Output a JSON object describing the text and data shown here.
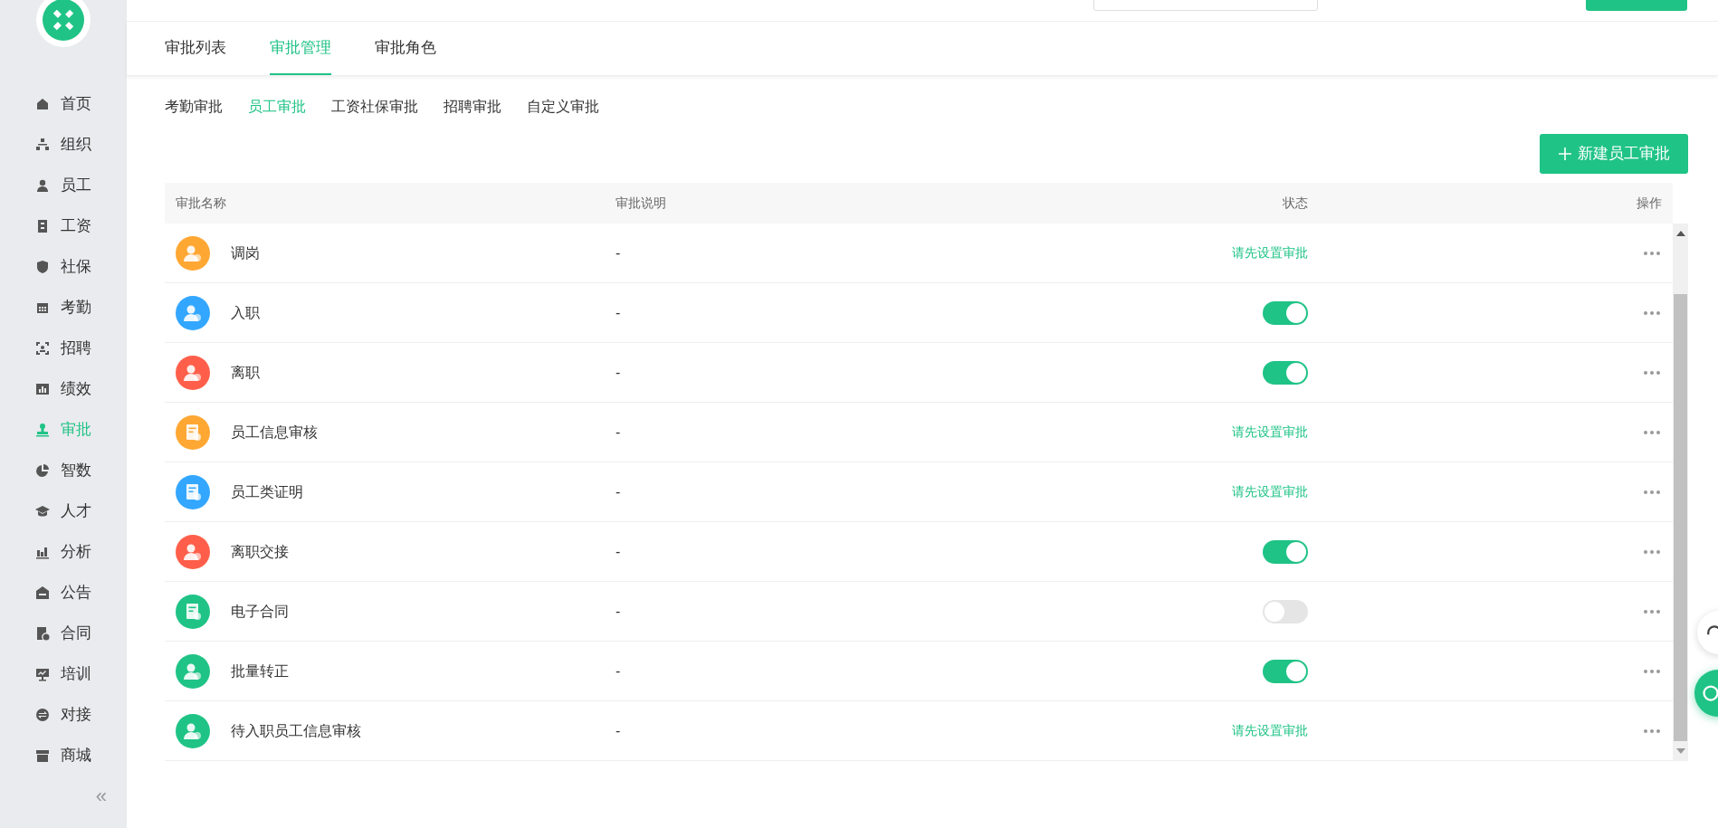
{
  "sidebar": {
    "items": [
      {
        "label": "首页",
        "selected": false
      },
      {
        "label": "组织",
        "selected": false
      },
      {
        "label": "员工",
        "selected": false
      },
      {
        "label": "工资",
        "selected": false
      },
      {
        "label": "社保",
        "selected": false
      },
      {
        "label": "考勤",
        "selected": false
      },
      {
        "label": "招聘",
        "selected": false
      },
      {
        "label": "绩效",
        "selected": false
      },
      {
        "label": "审批",
        "selected": true
      },
      {
        "label": "智数",
        "selected": false
      },
      {
        "label": "人才",
        "selected": false
      },
      {
        "label": "分析",
        "selected": false
      },
      {
        "label": "公告",
        "selected": false
      },
      {
        "label": "合同",
        "selected": false
      },
      {
        "label": "培训",
        "selected": false
      },
      {
        "label": "对接",
        "selected": false
      },
      {
        "label": "商城",
        "selected": false
      }
    ],
    "collapse": "«"
  },
  "tabs": [
    {
      "label": "审批列表",
      "selected": false
    },
    {
      "label": "审批管理",
      "selected": true
    },
    {
      "label": "审批角色",
      "selected": false
    }
  ],
  "subtabs": [
    {
      "label": "考勤审批",
      "selected": false
    },
    {
      "label": "员工审批",
      "selected": true
    },
    {
      "label": "工资社保审批",
      "selected": false
    },
    {
      "label": "招聘审批",
      "selected": false
    },
    {
      "label": "自定义审批",
      "selected": false
    }
  ],
  "new_button": "新建员工审批",
  "table": {
    "columns": [
      "审批名称",
      "审批说明",
      "状态",
      "操作"
    ],
    "rows": [
      {
        "name": "调岗",
        "color": "#ffa733",
        "description": "-",
        "kind": "text",
        "status": "请先设置审批"
      },
      {
        "name": "入职",
        "color": "#33a7ff",
        "description": "-",
        "kind": "switch",
        "on": true
      },
      {
        "name": "离职",
        "color": "#ff5f4a",
        "description": "-",
        "kind": "switch",
        "on": true
      },
      {
        "name": "员工信息审核",
        "color": "#ffa733",
        "description": "-",
        "kind": "text",
        "status": "请先设置审批"
      },
      {
        "name": "员工类证明",
        "color": "#33a7ff",
        "description": "-",
        "kind": "text",
        "status": "请先设置审批"
      },
      {
        "name": "离职交接",
        "color": "#ff5f4a",
        "description": "-",
        "kind": "switch",
        "on": true
      },
      {
        "name": "电子合同",
        "color": "#1fc386",
        "description": "-",
        "kind": "switch",
        "on": false
      },
      {
        "name": "批量转正",
        "color": "#1fc386",
        "description": "-",
        "kind": "switch",
        "on": true
      },
      {
        "name": "待入职员工信息审核",
        "color": "#1fc386",
        "description": "-",
        "kind": "text",
        "status": "请先设置审批"
      }
    ]
  }
}
